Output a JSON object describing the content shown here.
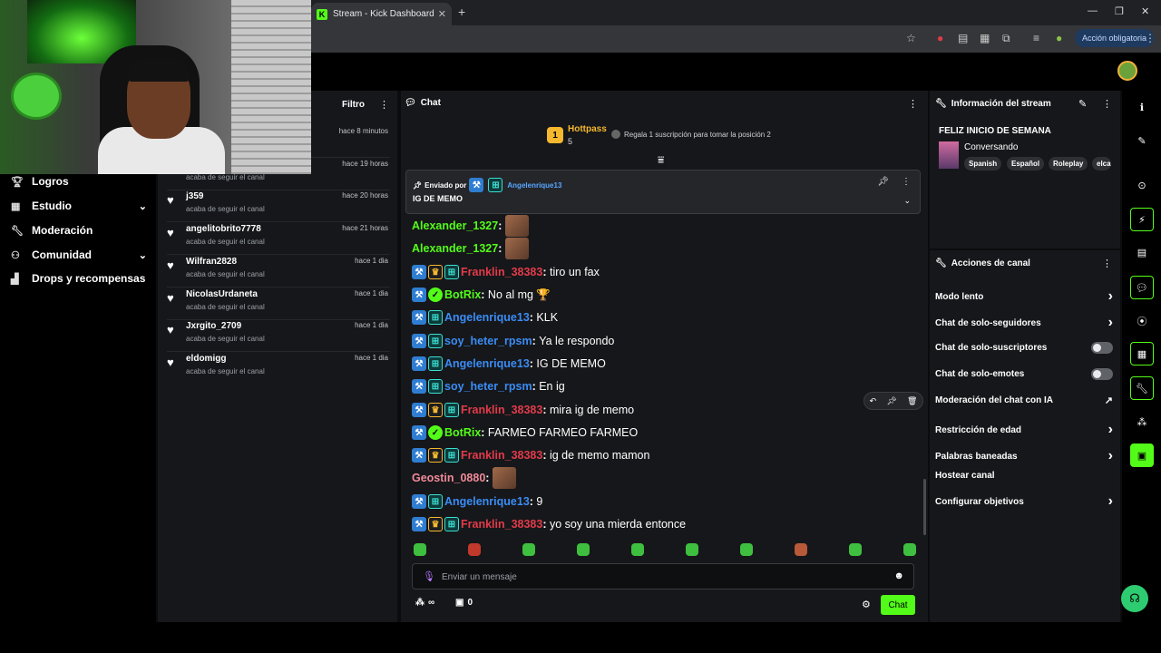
{
  "browser": {
    "tab_title": "Stream - Kick Dashboard",
    "favicon_letter": "K",
    "new_tab": "+",
    "close_tab": "✕",
    "required_action": "Acción obligatoria"
  },
  "nav": [
    {
      "label": "Logros",
      "icon": "trophy-icon",
      "has_chevron": false
    },
    {
      "label": "Estudio",
      "icon": "studio-icon",
      "has_chevron": true
    },
    {
      "label": "Moderación",
      "icon": "wrench-icon",
      "has_chevron": false
    },
    {
      "label": "Comunidad",
      "icon": "community-icon",
      "has_chevron": true
    },
    {
      "label": "Drops y recompensas",
      "icon": "chart-icon",
      "has_chevron": false
    }
  ],
  "followers": {
    "filter_label": "Filtro",
    "rows": [
      {
        "name": "",
        "sub": "",
        "time": "hace 8 minutos"
      },
      {
        "name": "",
        "sub": "acaba de seguir el canal",
        "time": "hace 19 horas"
      },
      {
        "name": "j359",
        "sub": "acaba de seguir el canal",
        "time": "hace 20 horas"
      },
      {
        "name": "angelitobrito7778",
        "sub": "acaba de seguir el canal",
        "time": "hace 21 horas"
      },
      {
        "name": "Wilfran2828",
        "sub": "acaba de seguir el canal",
        "time": "hace 1 dia"
      },
      {
        "name": "NicolasUrdaneta",
        "sub": "acaba de seguir el canal",
        "time": "hace 1 dia"
      },
      {
        "name": "Jxrgito_2709",
        "sub": "acaba de seguir el canal",
        "time": "hace 1 dia"
      },
      {
        "name": "eldomigg",
        "sub": "acaba de seguir el canal",
        "time": "hace 1 dia"
      }
    ]
  },
  "chat": {
    "title": "Chat",
    "hottpass": {
      "rank": "1",
      "name": "Hottpass",
      "count": "5",
      "gift_text": "Regala 1 suscripción para tomar la posición 2"
    },
    "pinned": {
      "label": "Enviado por",
      "user": "Angelenrique13",
      "message": "IG DE MEMO"
    },
    "messages": [
      {
        "badges": [],
        "user": "Alexander_1327",
        "color": "green",
        "text": "",
        "emote": true
      },
      {
        "badges": [],
        "user": "Alexander_1327",
        "color": "green",
        "text": "",
        "emote": true
      },
      {
        "badges": [
          "mod",
          "vip",
          "sub"
        ],
        "user": "Franklin_38383",
        "color": "red",
        "text": "tiro un fax",
        "emote": false
      },
      {
        "badges": [
          "mod",
          "ver"
        ],
        "user": "BotRix",
        "color": "green",
        "text": "No al mg 🏆",
        "emote": false
      },
      {
        "badges": [
          "mod",
          "sub"
        ],
        "user": "Angelenrique13",
        "color": "blue",
        "text": "KLK",
        "emote": false
      },
      {
        "badges": [
          "mod",
          "sub"
        ],
        "user": "soy_heter_rpsm",
        "color": "blue",
        "text": "Ya le respondo",
        "emote": false
      },
      {
        "badges": [
          "mod",
          "sub"
        ],
        "user": "Angelenrique13",
        "color": "blue",
        "text": "IG DE MEMO",
        "emote": false
      },
      {
        "badges": [
          "mod",
          "sub"
        ],
        "user": "soy_heter_rpsm",
        "color": "blue",
        "text": "En ig",
        "emote": false
      },
      {
        "badges": [
          "mod",
          "vip",
          "sub"
        ],
        "user": "Franklin_38383",
        "color": "red",
        "text": "mira ig de memo",
        "emote": false
      },
      {
        "badges": [
          "mod",
          "ver"
        ],
        "user": "BotRix",
        "color": "green",
        "text": "FARMEO FARMEO FARMEO",
        "emote": false
      },
      {
        "badges": [
          "mod",
          "vip",
          "sub"
        ],
        "user": "Franklin_38383",
        "color": "red",
        "text": "ig de memo mamon",
        "emote": false
      },
      {
        "badges": [],
        "user": "Geostin_0880",
        "color": "pink",
        "text": "",
        "emote": true
      },
      {
        "badges": [
          "mod",
          "sub"
        ],
        "user": "Angelenrique13",
        "color": "blue",
        "text": "9",
        "emote": false
      },
      {
        "badges": [
          "mod",
          "vip",
          "sub"
        ],
        "user": "Franklin_38383",
        "color": "red",
        "text": "yo soy una mierda entonce",
        "emote": false
      }
    ],
    "input_placeholder": "Enviar un mensaje",
    "points_symbol": "∞",
    "store_count": "0",
    "send_label": "Chat"
  },
  "stream_info": {
    "title": "Información del stream",
    "stream_title": "FELIZ INICIO DE SEMANA",
    "category": "Conversando",
    "tags": [
      "Spanish",
      "Español",
      "Roleplay",
      "elca"
    ]
  },
  "channel_actions": {
    "title": "Acciones de canal",
    "rows": [
      {
        "label": "Modo lento",
        "control": "chevron"
      },
      {
        "label": "Chat de solo-seguidores",
        "control": "chevron"
      },
      {
        "label": "Chat de solo-suscriptores",
        "control": "toggle"
      },
      {
        "label": "Chat de solo-emotes",
        "control": "toggle"
      },
      {
        "label": "Moderación del chat con IA",
        "control": "external"
      },
      {
        "label": "Restricción de edad",
        "control": "chevron"
      },
      {
        "label": "Palabras baneadas",
        "control": "chevron"
      },
      {
        "label": "Hostear canal",
        "control": "none"
      },
      {
        "label": "Configurar objetivos",
        "control": "chevron"
      }
    ]
  },
  "colors": {
    "accent": "#53fc18",
    "panel": "#16171a",
    "red_user": "#e23b4a",
    "blue_user": "#3a8cf5"
  }
}
